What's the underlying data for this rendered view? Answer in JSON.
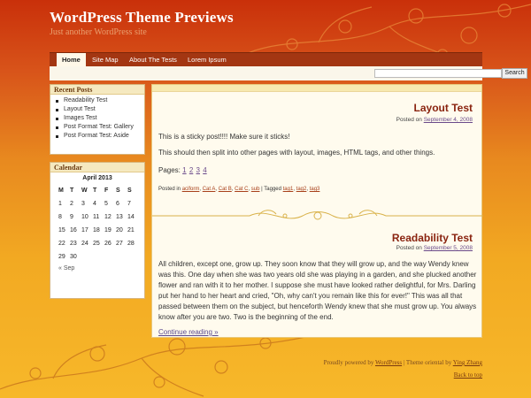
{
  "header": {
    "title": "WordPress Theme Previews",
    "description": "Just another WordPress site"
  },
  "nav": {
    "items": [
      {
        "label": "Home",
        "active": true
      },
      {
        "label": "Site Map"
      },
      {
        "label": "About The Tests"
      },
      {
        "label": "Lorem Ipsum"
      }
    ]
  },
  "search": {
    "button_label": "Search",
    "value": ""
  },
  "recent_posts": {
    "title": "Recent Posts",
    "items": [
      "Readability Test",
      "Layout Test",
      "Images Test",
      "Post Format Test: Gallery",
      "Post Format Test: Aside"
    ]
  },
  "calendar": {
    "title": "Calendar",
    "caption": "April 2013",
    "weekdays": [
      "M",
      "T",
      "W",
      "T",
      "F",
      "S",
      "S"
    ],
    "rows": [
      [
        "1",
        "2",
        "3",
        "4",
        "5",
        "6",
        "7"
      ],
      [
        "8",
        "9",
        "10",
        "11",
        "12",
        "13",
        "14"
      ],
      [
        "15",
        "16",
        "17",
        "18",
        "19",
        "20",
        "21"
      ],
      [
        "22",
        "23",
        "24",
        "25",
        "26",
        "27",
        "28"
      ],
      [
        "29",
        "30",
        "",
        "",
        "",
        "",
        ""
      ]
    ],
    "prev_link": "« Sep"
  },
  "posts": [
    {
      "title": "Layout Test",
      "posted_prefix": "Posted on",
      "date": "September 4, 2008",
      "paragraphs": [
        "This is a sticky post!!!! Make sure it sticks!",
        "This should then split into other pages with layout, images, HTML tags, and other things."
      ],
      "pages_label": "Pages:",
      "pages": [
        "1",
        "2",
        "3",
        "4"
      ],
      "meta": {
        "posted_in_label": "Posted in",
        "categories": [
          "aciform",
          "Cat A",
          "Cat B",
          "Cat C",
          "sub"
        ],
        "tagged_label": "Tagged",
        "tags": [
          "tag1",
          "tag2",
          "tag3"
        ]
      }
    },
    {
      "title": "Readability Test",
      "posted_prefix": "Posted on",
      "date": "September 5, 2008",
      "paragraphs": [
        "All children, except one, grow up. They soon know that they will grow up, and the way Wendy knew was this. One day when she was two years old she was playing in a garden, and she plucked another flower and ran with it to her mother. I suppose she must have looked rather delightful, for Mrs. Darling put her hand to her heart and cried, \"Oh, why can't you remain like this for ever!\" This was all that passed between them on the subject, but henceforth Wendy knew that she must grow up. You always know after you are two. Two is the beginning of the end."
      ],
      "continue_label": "Continue reading »"
    }
  ],
  "footer": {
    "powered_prefix": "Proudly powered by",
    "wordpress": "WordPress",
    "theme_prefix": "Theme oriental by",
    "author": "Ying Zhang",
    "back_to_top": "Back to top"
  },
  "colors": {
    "accent": "#8a2410",
    "nav_bg": "#a33612",
    "link": "#6a4a8a"
  }
}
